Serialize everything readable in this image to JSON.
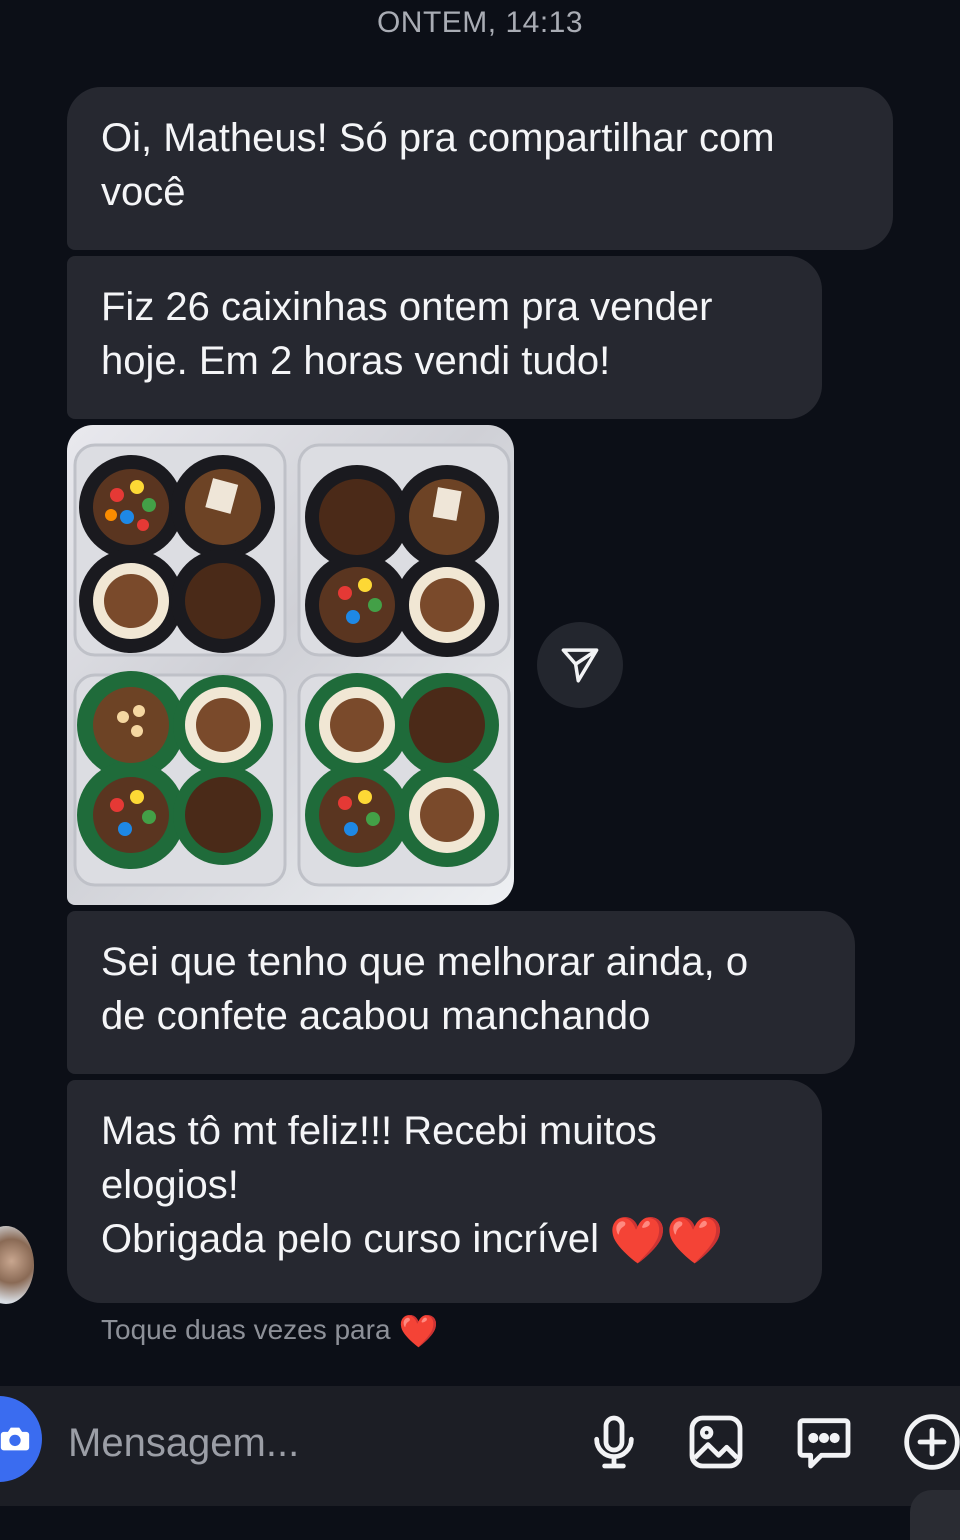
{
  "thread": {
    "timestamp": "ONTEM, 14:13",
    "messages": [
      {
        "text": "Oi, Matheus! Só pra compartilhar com\nvocê"
      },
      {
        "text": "Fiz 26 caixinhas ontem pra vender\nhoje. Em 2 horas vendi tudo!"
      },
      {
        "text": "Sei que tenho que melhorar ainda, o\nde confete acabou manchando"
      },
      {
        "text": "Mas tô mt feliz!!! Recebi muitos\nelogios!\nObrigada pelo curso incrível",
        "emoji": "❤️❤️"
      }
    ],
    "hint": "Toque duas vezes para",
    "hint_emoji": "❤️"
  },
  "composer": {
    "placeholder": "Mensagem..."
  },
  "icons": [
    "camera-icon",
    "share-icon",
    "microphone-icon",
    "gallery-icon",
    "sticker-icon",
    "plus-icon"
  ],
  "colors": {
    "background": "#0c0f17",
    "bubble": "#262830",
    "accent": "#3a6cf0",
    "heart": "#e11d2a"
  }
}
